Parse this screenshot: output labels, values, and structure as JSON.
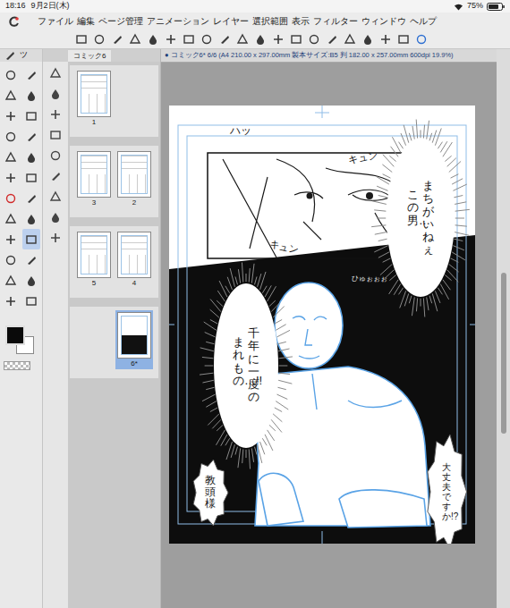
{
  "status_bar": {
    "time": "18:16",
    "date": "9月2日(木)",
    "battery": "75%"
  },
  "menu": [
    "ファイル",
    "編集",
    "ページ管理",
    "アニメーション",
    "レイヤー",
    "選択範囲",
    "表示",
    "フィルター",
    "ウィンドウ",
    "ヘルプ"
  ],
  "tool_tab": {
    "label": "ツ"
  },
  "tools": [
    {
      "selected": false
    },
    {
      "selected": false
    },
    {
      "selected": false
    },
    {
      "selected": false
    },
    {
      "selected": false
    },
    {
      "selected": false
    },
    {
      "selected": false
    },
    {
      "selected": false
    },
    {
      "selected": false
    },
    {
      "selected": false
    },
    {
      "selected": false
    },
    {
      "selected": false
    },
    {
      "selected": false
    },
    {
      "selected": false
    },
    {
      "selected": false
    },
    {
      "selected": false
    },
    {
      "selected": false
    },
    {
      "selected": true
    },
    {
      "selected": false
    },
    {
      "selected": false
    },
    {
      "selected": false
    },
    {
      "selected": false
    },
    {
      "selected": false
    },
    {
      "selected": false
    }
  ],
  "colors": {
    "main": "#0a0a0a",
    "sub": "#ffffff"
  },
  "panel_tab": {
    "label": "コミック6"
  },
  "spreads": [
    {
      "pages": [
        {
          "label": "1",
          "selected": false,
          "dark": false
        }
      ]
    },
    {
      "pages": [
        {
          "label": "3",
          "selected": false,
          "dark": false
        },
        {
          "label": "2",
          "selected": false,
          "dark": false
        }
      ]
    },
    {
      "pages": [
        {
          "label": "5",
          "selected": false,
          "dark": false
        },
        {
          "label": "4",
          "selected": false,
          "dark": false
        }
      ]
    },
    {
      "pages": [
        {
          "label": "6*",
          "selected": true,
          "dark": true
        }
      ]
    }
  ],
  "document_tab": {
    "label": "● コミック6* 6/6 (A4 210.00 x 297.00mm 製本サイズ:B5 判 182.00 x 257.00mm 600dpi 19.9%)"
  },
  "manga": {
    "balloons": [
      {
        "kind": "spiky",
        "lines": [
          "まちがいねぇ",
          "この男…"
        ]
      },
      {
        "kind": "spiky",
        "lines": [
          "千年に一度の",
          "まれもの…!!"
        ]
      },
      {
        "kind": "jagged",
        "lines": [
          "大丈夫ですか!?"
        ]
      },
      {
        "kind": "jagged",
        "lines": [
          "教頭様"
        ]
      }
    ],
    "sound_effects": [
      {
        "kind": "horizontal",
        "text": "キュン"
      },
      {
        "kind": "horizontal",
        "text": "キュン"
      },
      {
        "kind": "vertical",
        "text": "ハッ"
      },
      {
        "kind": "horizontal",
        "text": "ひゅぉぉぉ"
      }
    ]
  }
}
